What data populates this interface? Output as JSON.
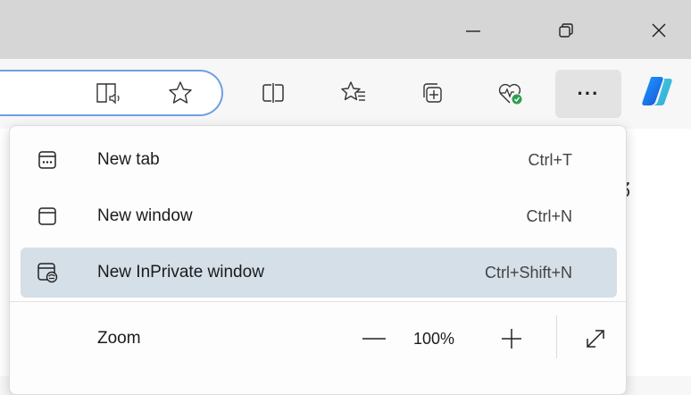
{
  "window_controls": {
    "minimize_icon": "minimize-icon",
    "restore_icon": "restore-icon",
    "close_icon": "close-icon"
  },
  "toolbar": {
    "icons": [
      "immersive-reader-icon",
      "favorite-star-icon",
      "split-screen-icon",
      "favorites-icon",
      "collections-icon",
      "browser-essentials-icon",
      "more-icon",
      "copilot-icon"
    ],
    "more_label": "···"
  },
  "menu": {
    "items": [
      {
        "label": "New tab",
        "shortcut": "Ctrl+T",
        "icon": "new-tab-icon"
      },
      {
        "label": "New window",
        "shortcut": "Ctrl+N",
        "icon": "new-window-icon"
      },
      {
        "label": "New InPrivate window",
        "shortcut": "Ctrl+Shift+N",
        "icon": "inprivate-icon",
        "highlighted": true
      }
    ],
    "zoom": {
      "label": "Zoom",
      "minus": "—",
      "value": "100%",
      "plus": "+"
    }
  },
  "colors": {
    "accent": "#6f9fe0",
    "highlight": "#d5dfe8",
    "titlebar": "#d6d6d6",
    "health_badge": "#2e9e4f"
  }
}
